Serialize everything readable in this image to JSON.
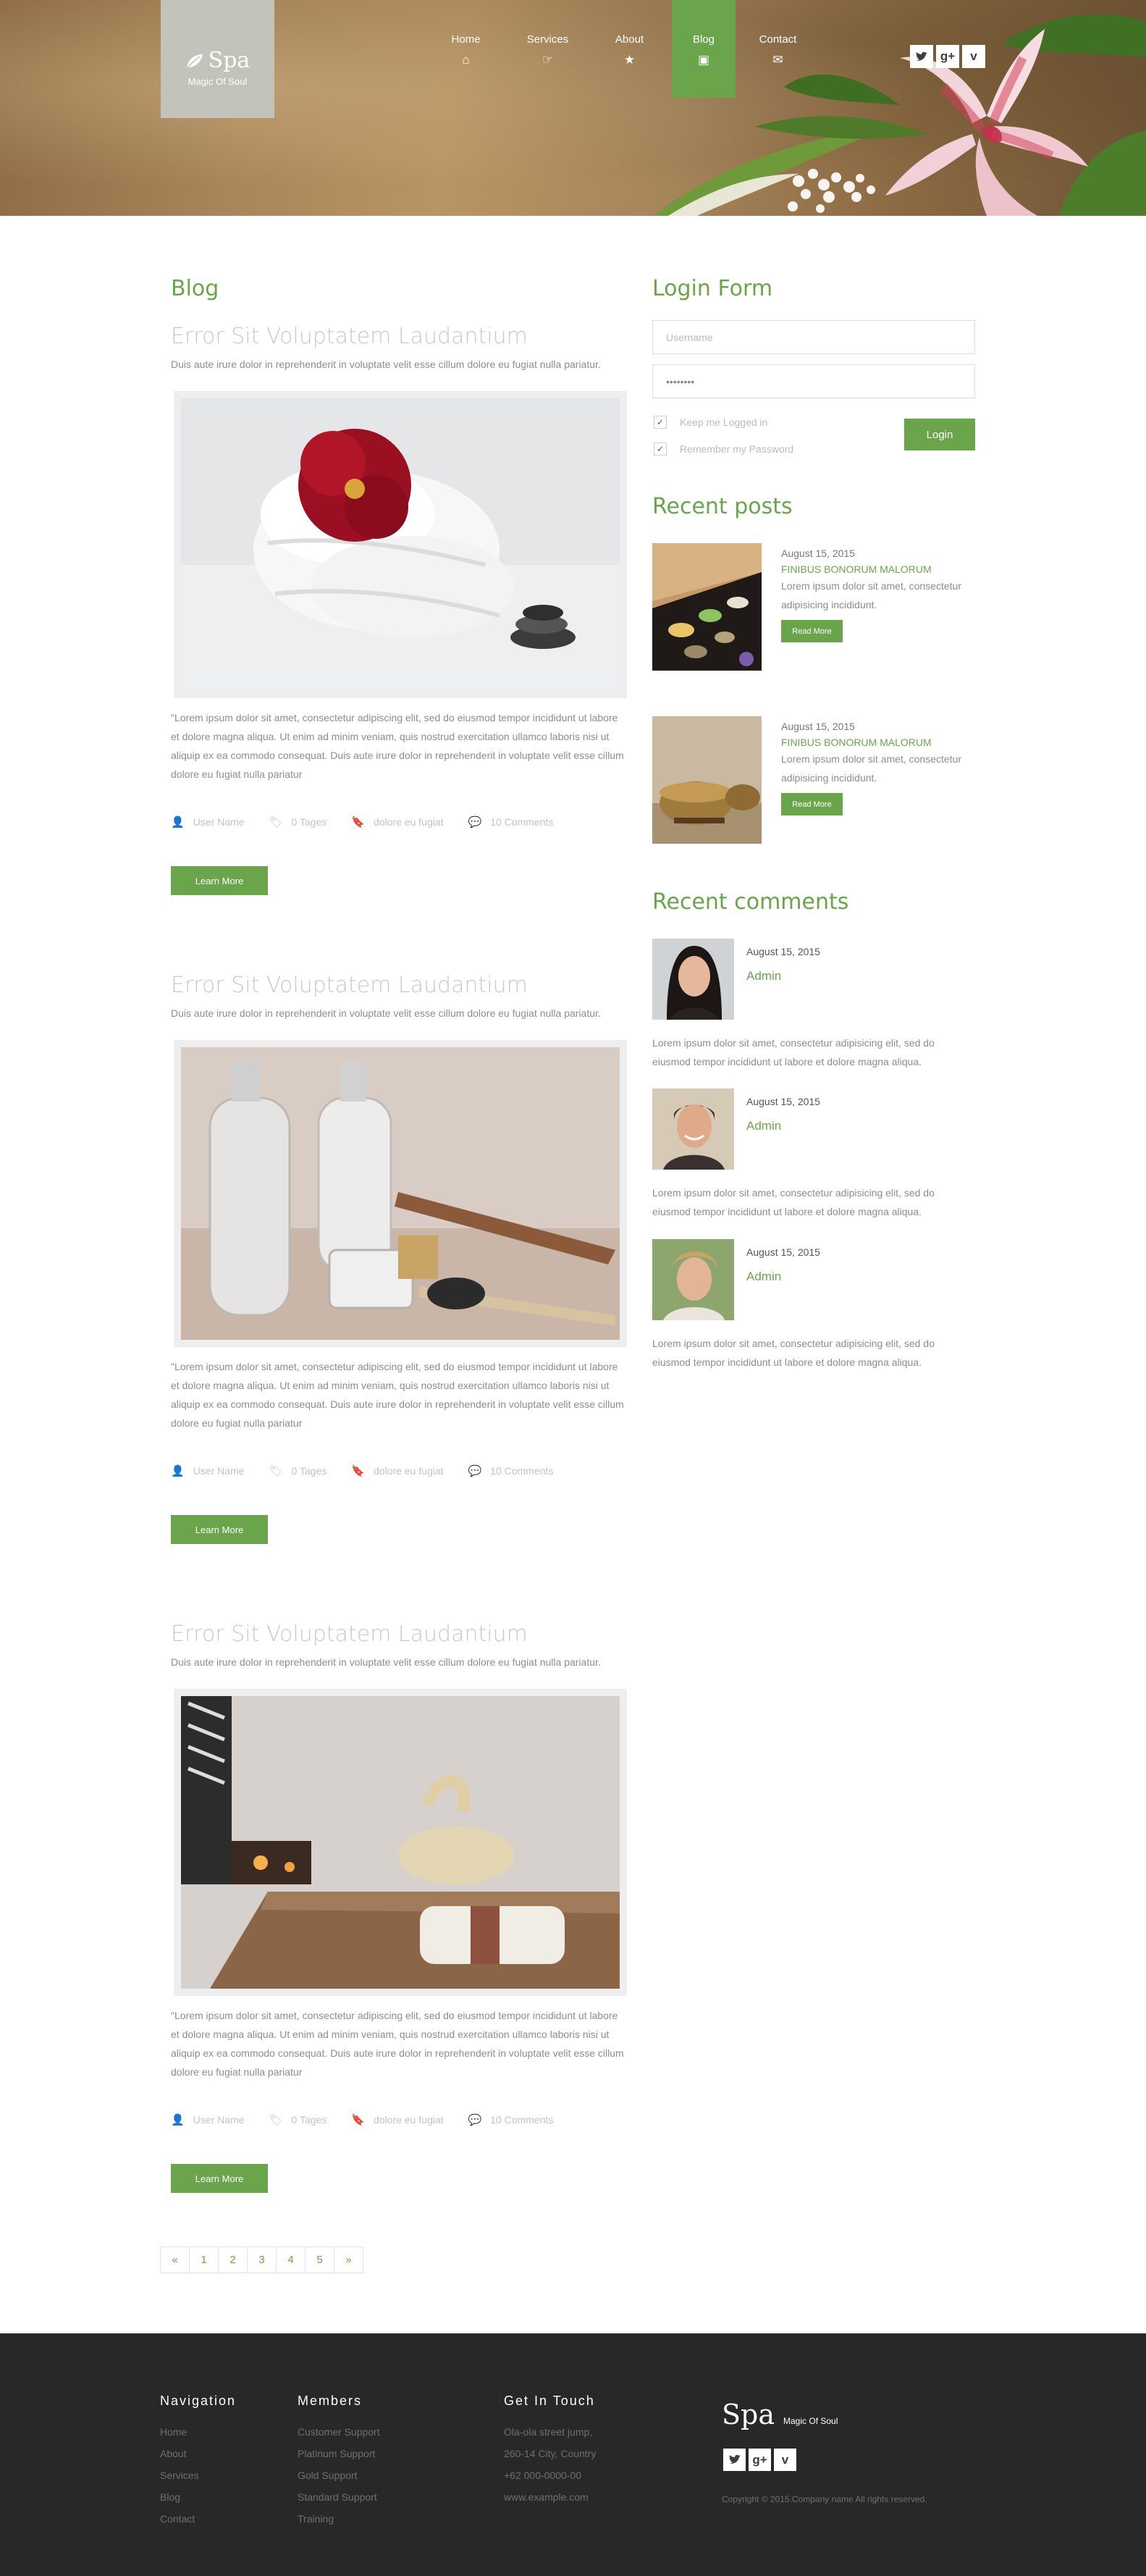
{
  "brand": {
    "name": "Spa",
    "tagline": "Magic Of Soul"
  },
  "nav": [
    {
      "label": "Home",
      "icon": "home-icon",
      "glyph": "⌂"
    },
    {
      "label": "Services",
      "icon": "hand-pointer-icon",
      "glyph": "☞"
    },
    {
      "label": "About",
      "icon": "star-icon",
      "glyph": "★"
    },
    {
      "label": "Blog",
      "icon": "picture-icon",
      "glyph": "▣",
      "active": true
    },
    {
      "label": "Contact",
      "icon": "envelope-icon",
      "glyph": "✉"
    }
  ],
  "social": [
    {
      "icon": "twitter-icon",
      "glyph": "🐦"
    },
    {
      "icon": "google-plus-icon",
      "glyph": "g+"
    },
    {
      "icon": "vimeo-icon",
      "glyph": "v"
    }
  ],
  "colors": {
    "accent": "#6aa54b",
    "footer_bg": "#282828"
  },
  "blog": {
    "heading": "Blog",
    "posts": [
      {
        "title": "Error Sit Voluptatem Laudantium",
        "lead": "Duis aute irure dolor in reprehenderit in voluptate velit esse cillum dolore eu fugiat nulla pariatur.",
        "body": "\"Lorem ipsum dolor sit amet, consectetur adipiscing elit, sed do eiusmod tempor incididunt ut labore et dolore magna aliqua. Ut enim ad minim veniam, quis nostrud exercitation ullamco laboris nisi ut aliquip ex ea commodo consequat. Duis aute irure dolor in reprehenderit in voluptate velit esse cillum dolore eu fugiat nulla pariatur",
        "author": "User Name",
        "tags": "0 Tages",
        "category": "dolore eu fugiat",
        "comments": "10 Comments",
        "button": "Learn More"
      },
      {
        "title": "Error Sit Voluptatem Laudantium",
        "lead": "Duis aute irure dolor in reprehenderit in voluptate velit esse cillum dolore eu fugiat nulla pariatur.",
        "body": "\"Lorem ipsum dolor sit amet, consectetur adipiscing elit, sed do eiusmod tempor incididunt ut labore et dolore magna aliqua. Ut enim ad minim veniam, quis nostrud exercitation ullamco laboris nisi ut aliquip ex ea commodo consequat. Duis aute irure dolor in reprehenderit in voluptate velit esse cillum dolore eu fugiat nulla pariatur",
        "author": "User Name",
        "tags": "0 Tages",
        "category": "dolore eu fugiat",
        "comments": "10 Comments",
        "button": "Learn More"
      },
      {
        "title": "Error Sit Voluptatem Laudantium",
        "lead": "Duis aute irure dolor in reprehenderit in voluptate velit esse cillum dolore eu fugiat nulla pariatur.",
        "body": "\"Lorem ipsum dolor sit amet, consectetur adipiscing elit, sed do eiusmod tempor incididunt ut labore et dolore magna aliqua. Ut enim ad minim veniam, quis nostrud exercitation ullamco laboris nisi ut aliquip ex ea commodo consequat. Duis aute irure dolor in reprehenderit in voluptate velit esse cillum dolore eu fugiat nulla pariatur",
        "author": "User Name",
        "tags": "0 Tages",
        "category": "dolore eu fugiat",
        "comments": "10 Comments",
        "button": "Learn More"
      }
    ]
  },
  "pagination": [
    "«",
    "1",
    "2",
    "3",
    "4",
    "5",
    "»"
  ],
  "login": {
    "heading": "Login Form",
    "username_placeholder": "Username",
    "password_value": "••••••••",
    "keep_logged": "Keep me Logged in",
    "remember": "Remember my Password",
    "button": "Login"
  },
  "recent_posts": {
    "heading": "Recent posts",
    "items": [
      {
        "date": "August 15, 2015",
        "category": "FINIBUS BONORUM MALORUM",
        "text": "Lorem ipsum dolor sit amet, consectetur adipisicing incididunt.",
        "button": "Read More"
      },
      {
        "date": "August 15, 2015",
        "category": "FINIBUS BONORUM MALORUM",
        "text": "Lorem ipsum dolor sit amet, consectetur adipisicing incididunt.",
        "button": "Read More"
      }
    ]
  },
  "recent_comments": {
    "heading": "Recent comments",
    "items": [
      {
        "date": "August 15, 2015",
        "author": "Admin",
        "text": "Lorem ipsum dolor sit amet, consectetur adipisicing elit, sed do eiusmod tempor incididunt ut labore et dolore magna aliqua."
      },
      {
        "date": "August 15, 2015",
        "author": "Admin",
        "text": "Lorem ipsum dolor sit amet, consectetur adipisicing elit, sed do eiusmod tempor incididunt ut labore et dolore magna aliqua."
      },
      {
        "date": "August 15, 2015",
        "author": "Admin",
        "text": "Lorem ipsum dolor sit amet, consectetur adipisicing elit, sed do eiusmod tempor incididunt ut labore et dolore magna aliqua."
      }
    ]
  },
  "footer": {
    "navigation": {
      "heading": "Navigation",
      "links": [
        "Home",
        "About",
        "Services",
        "Blog",
        "Contact"
      ]
    },
    "members": {
      "heading": "Members",
      "links": [
        "Customer Support",
        "Platinum Support",
        "Gold Support",
        "Standard Support",
        "Training"
      ]
    },
    "contact": {
      "heading": "Get In Touch",
      "lines": [
        "Ola-ola street jump,",
        "260-14 City, Country",
        "+62 000-0000-00",
        "www.example.com"
      ]
    },
    "brand": "Spa",
    "tagline": "Magic Of Soul",
    "copyright": "Copyright © 2015.Company name All rights reserved."
  }
}
